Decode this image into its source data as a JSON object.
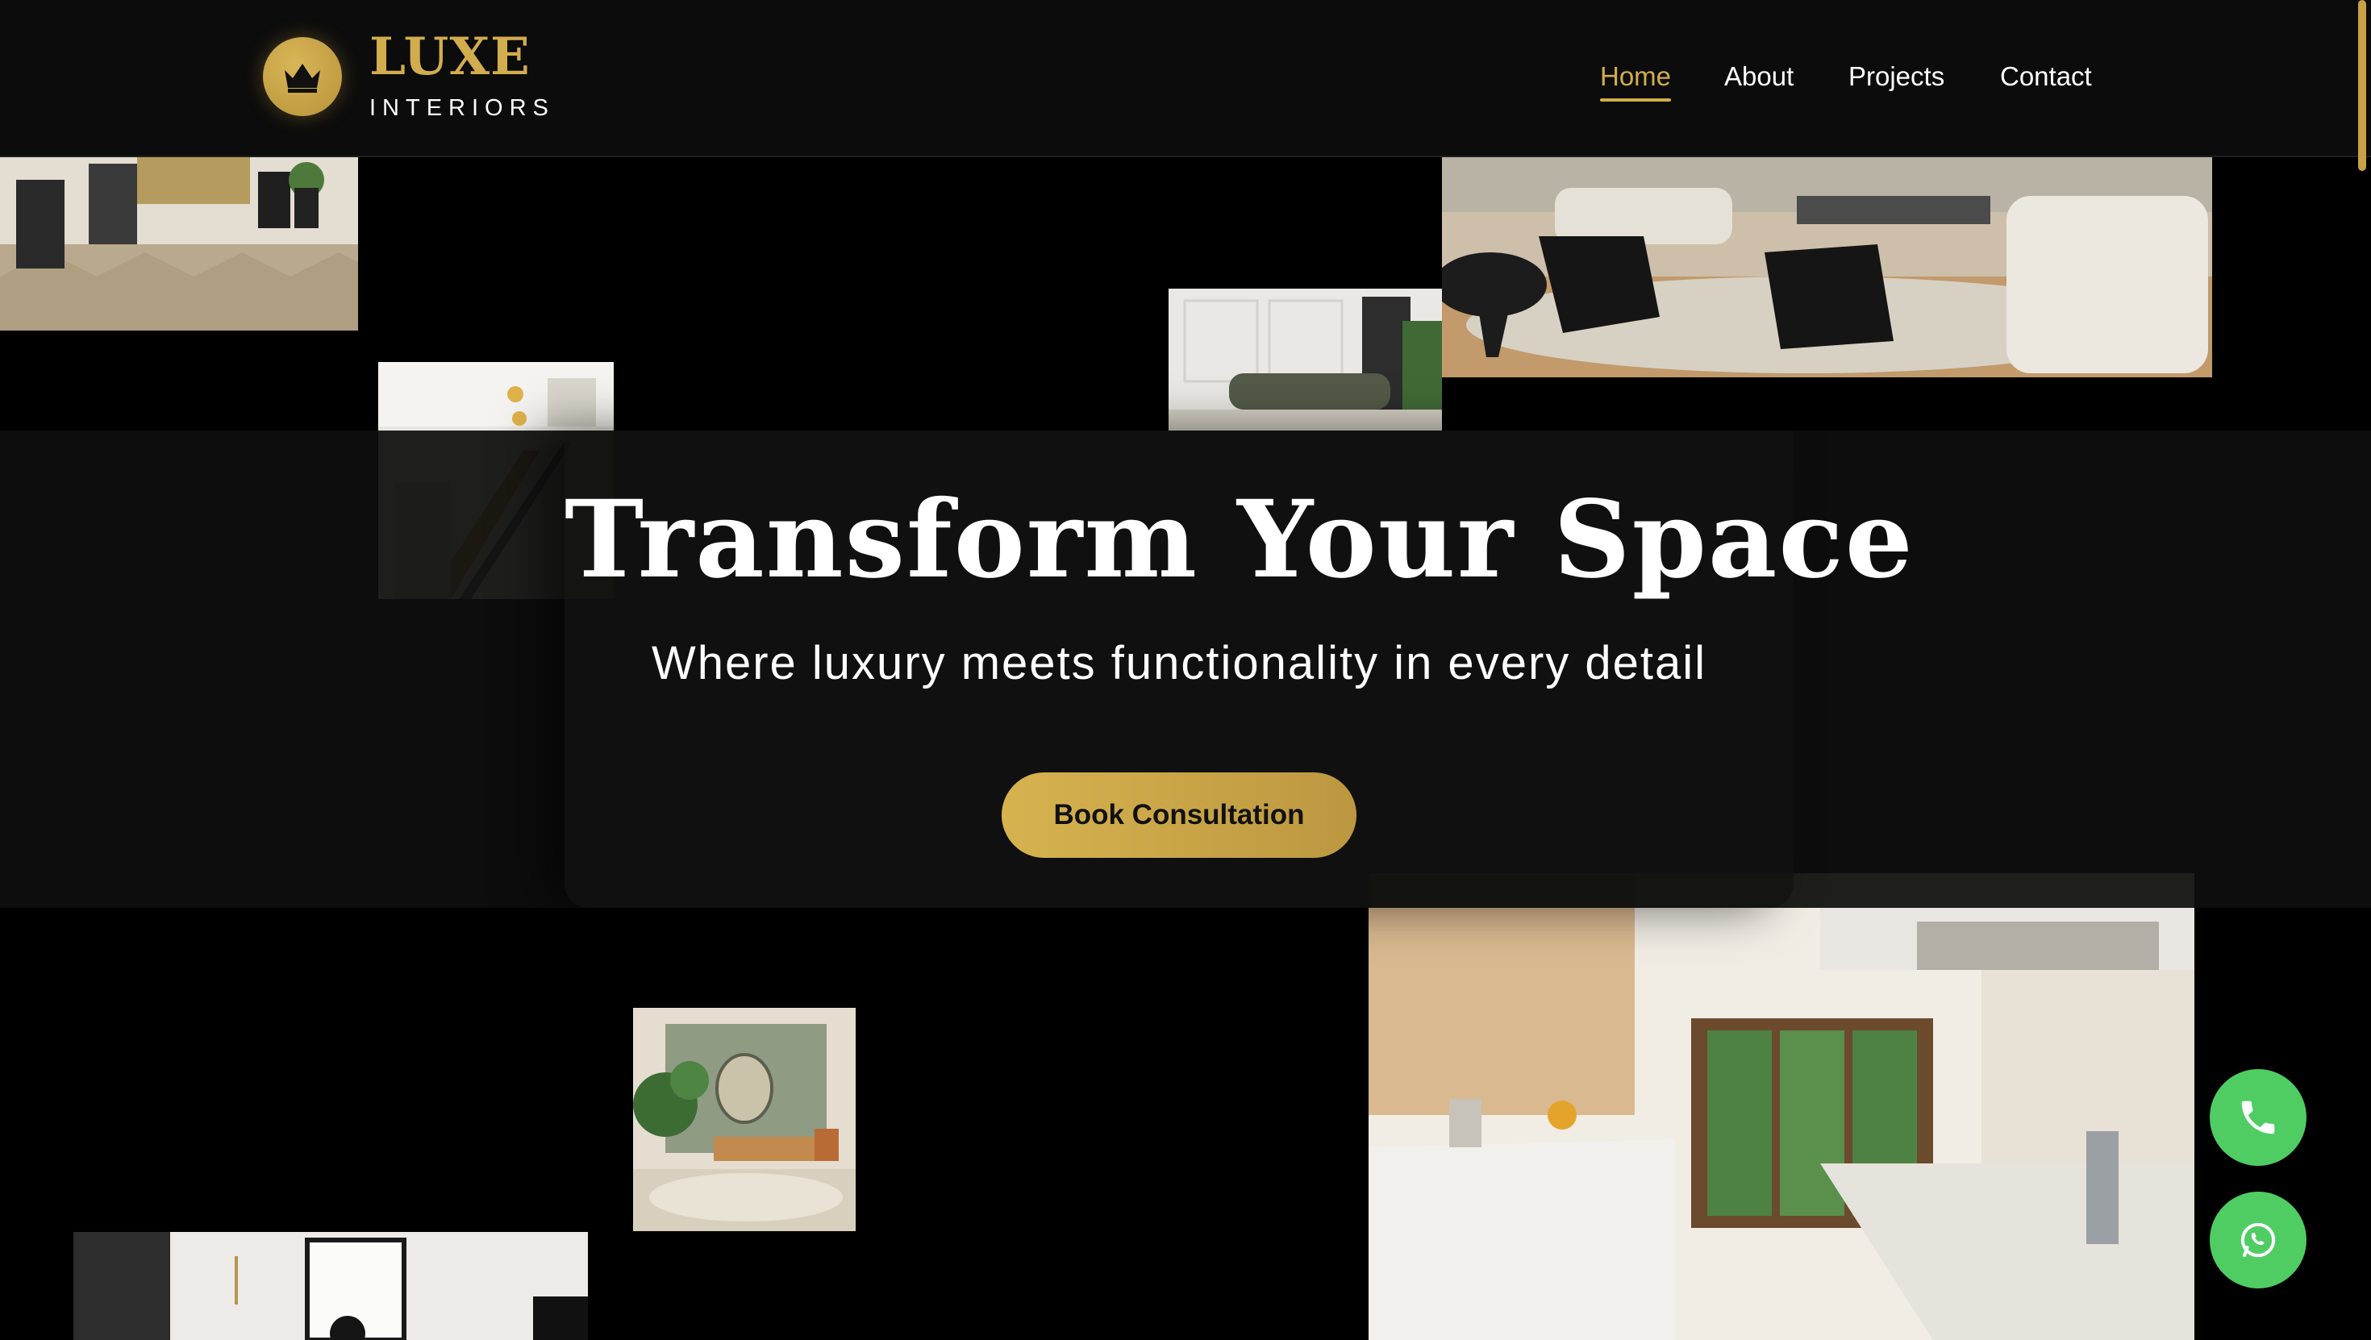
{
  "brand": {
    "name": "LUXE",
    "tagline": "INTERIORS",
    "icon": "crown-icon",
    "accent_color": "#d2ad4e"
  },
  "nav": {
    "items": [
      {
        "label": "Home",
        "active": true
      },
      {
        "label": "About",
        "active": false
      },
      {
        "label": "Projects",
        "active": false
      },
      {
        "label": "Contact",
        "active": false
      }
    ]
  },
  "hero": {
    "title": "Transform Your Space",
    "subtitle": "Where luxury meets functionality in every detail",
    "cta_label": "Book Consultation"
  },
  "gallery": {
    "photos": [
      "living-room-herringbone-floor",
      "staircase-interior",
      "sage-sofa-paneled-wall",
      "black-armchairs-lounge",
      "green-wall-living-room",
      "kitchen-interior",
      "framed-art-wall"
    ]
  },
  "actions": {
    "phone_icon": "phone-icon",
    "whatsapp_icon": "whatsapp-icon",
    "color": "#4fcd63"
  }
}
